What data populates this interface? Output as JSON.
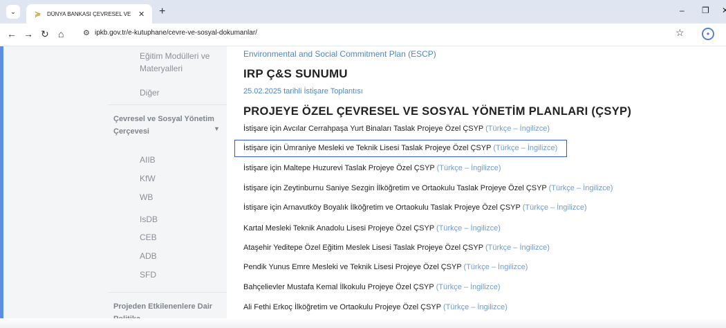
{
  "browser": {
    "tab_title": "DÜNYA BANKASI ÇEVRESEL VE",
    "url": "ipkb.gov.tr/e-kutuphane/cevre-ve-sosyal-dokumanlar/"
  },
  "sidebar": {
    "top_items": [
      "Eğitim Modülleri ve",
      "Materyalleri",
      "Diğer"
    ],
    "group1": "Çevresel ve Sosyal Yönetim Çerçevesi",
    "group1_items": [
      "AIIB",
      "KfW",
      "WB",
      "IsDB",
      "CEB",
      "ADB",
      "SFD"
    ],
    "group2": "Projeden Etkilenenlere Dair Politika"
  },
  "content": {
    "top_link": "Environmental and Social Commitment Plan (ESCP)",
    "heading1": "IRP Ç&S SUNUMU",
    "date_link": "25.02.2025 tarihli İstişare Toplantısı",
    "heading2": "PROJEYE ÖZEL ÇEVRESEL VE SOSYAL YÖNETİM PLANLARI (ÇSYP)",
    "lang_label": "(Türkçe – İngilizce)",
    "documents": [
      "İstişare için Avcılar Cerrahpaşa Yurt Binaları Taslak Projeye Özel ÇSYP",
      "İstişare için Ümraniye Mesleki ve Teknik Lisesi Taslak Projeye Özel ÇSYP",
      "İstişare için Maltepe Huzurevi Taslak Projeye Özel ÇSYP",
      "İstişare için Zeytinburnu Saniye Sezgin İlköğretim ve Ortaokulu Taslak Projeye Özel ÇSYP",
      "İstişare için Arnavutköy Boyalık İlköğretim ve Ortaokulu Taslak Projeye Özel ÇSYP",
      "Kartal Mesleki Teknik Anadolu Lisesi Projeye Özel ÇSYP",
      "Ataşehir Yeditepe Özel Eğitim Meslek Lisesi Taslak Projeye Özel ÇSYP",
      "Pendik Yunus Emre Mesleki ve Teknik Lisesi Projeye Özel ÇSYP",
      "Bahçelievler Mustafa Kemal İlkokulu Projeye Özel ÇSYP",
      "Ali Fethi Erkoç İlköğretim ve Ortaokulu Projeye Özel ÇSYP"
    ]
  }
}
